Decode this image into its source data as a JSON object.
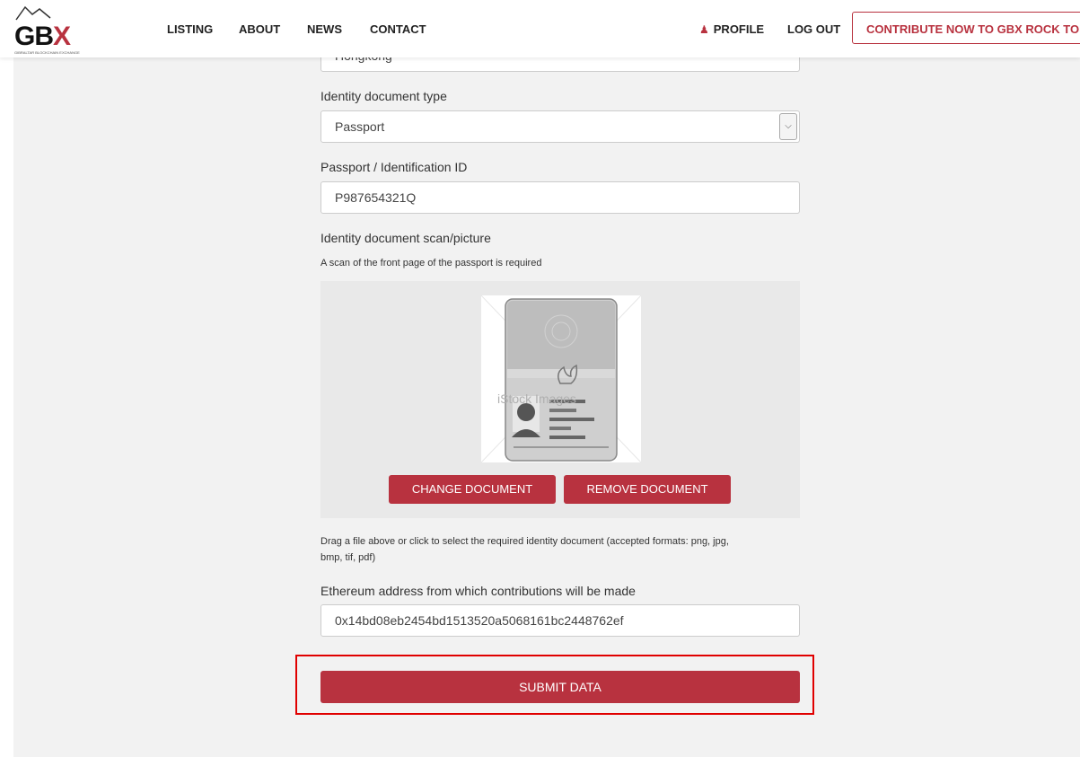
{
  "header": {
    "logo_text": "GBX",
    "logo_tagline": "GIBRALTAR BLOCKCHAIN EXCHANGE",
    "nav": [
      "LISTING",
      "ABOUT",
      "NEWS",
      "CONTACT"
    ],
    "profile_label": "PROFILE",
    "logout_label": "LOG OUT",
    "cta_label": "CONTRIBUTE NOW TO GBX ROCK TOKEN"
  },
  "form": {
    "country_value": "Hongkong",
    "doc_type_label": "Identity document type",
    "doc_type_value": "Passport",
    "id_label": "Passport / Identification ID",
    "id_value": "P987654321Q",
    "scan_label": "Identity document scan/picture",
    "scan_hint": "A scan of the front page of the passport is required",
    "watermark": "iStock Images",
    "change_doc_label": "CHANGE DOCUMENT",
    "remove_doc_label": "REMOVE DOCUMENT",
    "drag_hint": "Drag a file above or click to select the required identity document (accepted formats: png, jpg,",
    "drag_hint_2": "bmp, tif, pdf)",
    "eth_label": "Ethereum address from which contributions will be made",
    "eth_value": "0x14bd08eb2454bd1513520a5068161bc2448762ef",
    "submit_label": "SUBMIT DATA"
  },
  "colors": {
    "brand": "#b8323f",
    "highlight": "#e00000"
  }
}
